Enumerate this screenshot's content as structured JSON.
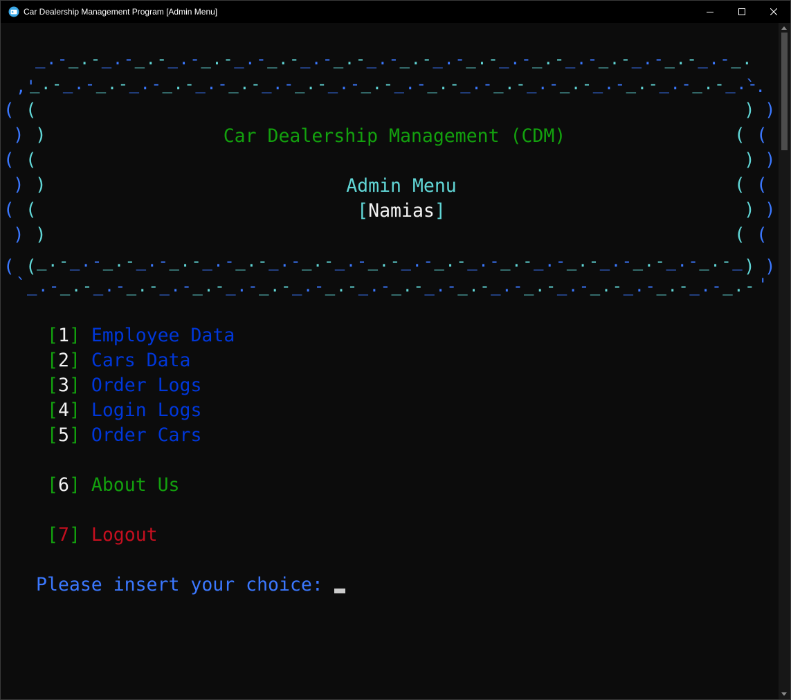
{
  "window": {
    "title": "Car Dealership Management Program [Admin Menu]",
    "icon": "terminal-app-icon",
    "controls": [
      "minimize-icon",
      "maximize-icon",
      "close-icon"
    ]
  },
  "banner": {
    "title": "Car Dealership Management (CDM)",
    "subtitle": "Admin Menu",
    "user_open": "[",
    "user_name": "Namias",
    "user_close": "]"
  },
  "menu": {
    "items": [
      {
        "open": "[",
        "key": "1",
        "close": "]",
        "label": "Employee Data"
      },
      {
        "open": "[",
        "key": "2",
        "close": "]",
        "label": "Cars Data"
      },
      {
        "open": "[",
        "key": "3",
        "close": "]",
        "label": "Order Logs"
      },
      {
        "open": "[",
        "key": "4",
        "close": "]",
        "label": "Login Logs"
      },
      {
        "open": "[",
        "key": "5",
        "close": "]",
        "label": "Order Cars"
      },
      {
        "open": "[",
        "key": "6",
        "close": "]",
        "label": "About Us"
      },
      {
        "open": "[",
        "key": "7",
        "close": "]",
        "label": "Logout"
      }
    ]
  },
  "prompt": {
    "text": "Please insert your choice:",
    "value": ""
  },
  "colors": {
    "background": "#0c0c0c",
    "cyan": "#61d6d6",
    "blue": "#3b78ff",
    "green": "#13a10e",
    "dark_blue": "#0037da",
    "red": "#c50f1f",
    "white": "#f2f2f2"
  }
}
